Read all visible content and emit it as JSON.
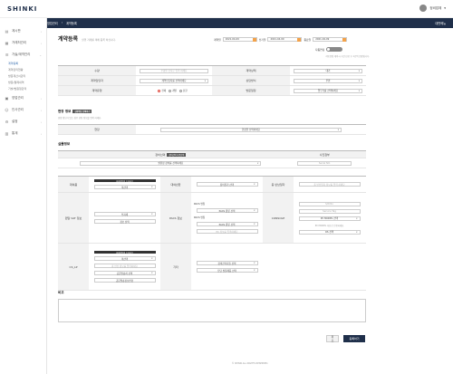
{
  "header": {
    "logo": "SHINKI",
    "user_name": "정비업체"
  },
  "sidebar": {
    "items": [
      {
        "label": "계시판",
        "icon": "board-icon"
      },
      {
        "label": "거래처관리",
        "icon": "building-icon"
      },
      {
        "label": "가술/계약관리",
        "icon": "contract-icon"
      }
    ],
    "sub_items": [
      "계약등록",
      "계약관리현황",
      "방문계산서관리",
      "방문/결제내역",
      "기술/법원청관리"
    ],
    "items_after": [
      {
        "label": "영업관리",
        "icon": "sales-icon"
      },
      {
        "label": "인사관리",
        "icon": "people-icon"
      },
      {
        "label": "설정",
        "icon": "gear-icon"
      },
      {
        "label": "통계",
        "icon": "chart-icon"
      }
    ]
  },
  "breadcrumb": {
    "home": "영업관리",
    "current": "계약등록",
    "right": "대판메뉴"
  },
  "page": {
    "title": "계약등록",
    "subtitle": "실행 거래를 객체 등록 하십니다."
  },
  "dates": [
    {
      "label": "계약일",
      "value": "2021-04-09"
    },
    {
      "label": "납기일",
      "value": "2021-04-09"
    },
    {
      "label": "종료일",
      "value": "2021-04-09"
    }
  ],
  "approve": {
    "label": "자동연장",
    "toggle_text": "미적"
  },
  "note": "자동연장 계약시 기간 만료 후 1년씩 연장됩니다.",
  "form": {
    "rows": [
      {
        "l1": "수량",
        "v1": "수량을 숫자로 입력 하세요",
        "l2": "계약상태",
        "v2": "대기"
      },
      {
        "l1": "계약담당자",
        "v1": "계약담당자를 선택하세요",
        "l2": "상담방식",
        "v2": "우편"
      },
      {
        "l1": "계약유형",
        "l2": "방문일정",
        "v2": "업무가를 선택하세요"
      }
    ],
    "radios": [
      "전체",
      "개별",
      "분할"
    ]
  },
  "owner": {
    "title": "현장 정보",
    "badge": "현장정보 선택하기",
    "hint": "현장 정보가 없는 경우 현장 정보를 입력 하세요.",
    "label": "현장",
    "placeholder": "현장을 선택하세요"
  },
  "contract_info": {
    "title": "실물정보",
    "header_left": "장비선택",
    "header_badge": "장비선택 다중선택",
    "header_right": "사진첨부",
    "select_placeholder": "실물정 장비를 선택하세요",
    "serial_placeholder": "Serial NO."
  },
  "grid": {
    "col_labels": [
      "대여품",
      "반납관계",
      "품목관리"
    ],
    "r1": {
      "label": "대여품",
      "dark": "미대여장비 조회하기",
      "sel": "미선택",
      "c2_label": "대여반환",
      "c2_sel": "장비유가 선택",
      "c3_label": "총 반납일자",
      "c3_inp": "총 반납일자 정보를 입력 하세요"
    },
    "r2": {
      "label": "렌탈 VAT 정보",
      "sel": "부과세",
      "btn": "정보 선택",
      "c2_label": "PACS 정보",
      "pacs_label": "PACS 명칭",
      "pacs_sel": "PACS 종류 선택",
      "pacs2_label": "PACS 명칭",
      "pacs2_sel": "PACS 종류 선택",
      "pacs_inp": "PC 정보를 입력하세요",
      "c3_label": "CONSOLE",
      "c3_inps": [
        "S/N No",
        "Service Tag"
      ],
      "c3_sel": "PC MODEL 선택",
      "c3_txt": "PC MODEL 자유로 진행하세요",
      "c3_sel2": "OS 선택"
    },
    "r3": {
      "label": "CS_LP",
      "dark": "미대여장비 조회하기",
      "sel": "미선택",
      "inp": "총 반납 정보를 입력하세요",
      "sel2": "공문발송처 선택",
      "btn": "공문발송정보변경",
      "c2_label": "기타",
      "c2_sel": "장비관리자들 선택",
      "c2_sel2": "담당 실물제품 선택"
    }
  },
  "memo": {
    "title": "비고"
  },
  "actions": {
    "cancel": "취소",
    "submit": "등록하기"
  },
  "footer": "© SHINKI.ALL RIGHTS RESERVED."
}
